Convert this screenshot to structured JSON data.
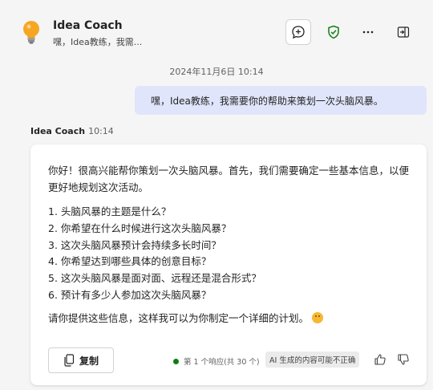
{
  "header": {
    "title": "Idea Coach",
    "subtitle": "嘿，Idea教练，我需..."
  },
  "conversation": {
    "timestamp": "2024年11月6日 10:14",
    "user_message": "嘿，Idea教练，我需要你的帮助来策划一次头脑风暴。",
    "bot_name": "Idea Coach",
    "bot_time": "10:14",
    "bot_intro": "你好！很高兴能帮你策划一次头脑风暴。首先，我们需要确定一些基本信息，以便更好地规划这次活动。",
    "questions": [
      "1.  头脑风暴的主题是什么？",
      "2.  你希望在什么时候进行这次头脑风暴？",
      "3.  这次头脑风暴预计会持续多长时间？",
      "4.  你希望达到哪些具体的创意目标？",
      "5.  这次头脑风暴是面对面、远程还是混合形式？",
      "6.  预计有多少人参加这次头脑风暴？"
    ],
    "bot_outro": "请你提供这些信息，这样我可以为你制定一个详细的计划。",
    "emoji_icon": "smiling-face-icon"
  },
  "footer": {
    "copy_label": "复制",
    "response_info": "第 1 个响应(共 30 个)",
    "ai_disclaimer": "AI 生成的内容可能不正确"
  },
  "colors": {
    "user_bubble": "#e0e5fb",
    "status_dot": "#107c10",
    "bulb": "#f6a623"
  },
  "icons": [
    "lightbulb-icon",
    "new-chat-icon",
    "shield-check-icon",
    "more-icon",
    "open-panel-icon",
    "copy-icon",
    "thumbs-up-icon",
    "thumbs-down-icon"
  ]
}
